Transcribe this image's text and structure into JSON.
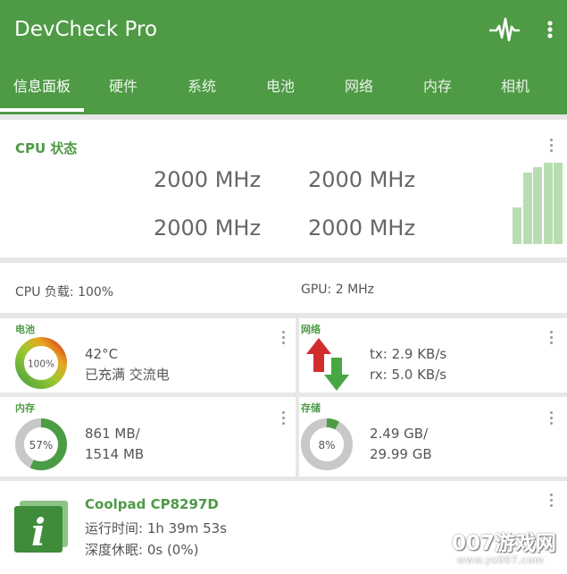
{
  "app": {
    "title": "DevCheck Pro",
    "icons": {
      "pulse": "pulse-icon",
      "more": "more-vert-icon"
    }
  },
  "tabs": [
    {
      "label": "信息面板",
      "active": true
    },
    {
      "label": "硬件"
    },
    {
      "label": "系统"
    },
    {
      "label": "电池"
    },
    {
      "label": "网络"
    },
    {
      "label": "内存"
    },
    {
      "label": "相机"
    }
  ],
  "cpu": {
    "title": "CPU 状态",
    "cores": [
      "2000 MHz",
      "2000 MHz",
      "2000 MHz",
      "2000 MHz"
    ],
    "load_bars": [
      0.45,
      0.88,
      0.95,
      1.0,
      1.0
    ]
  },
  "load": {
    "cpu": "CPU 负载: 100%",
    "gpu": "GPU: 2 MHz"
  },
  "battery": {
    "title": "电池",
    "percent_label": "100%",
    "percent": 100,
    "temp": "42°C",
    "status": "已充满 交流电"
  },
  "network": {
    "title": "网络",
    "tx": "tx: 2.9 KB/s",
    "rx": "rx: 5.0 KB/s"
  },
  "memory": {
    "title": "内存",
    "percent_label": "57%",
    "percent": 57,
    "used": "861 MB/",
    "total": "1514 MB"
  },
  "storage": {
    "title": "存储",
    "percent_label": "8%",
    "percent": 8,
    "used": "2.49 GB/",
    "total": "29.99 GB"
  },
  "device": {
    "name": "Coolpad CP8297D",
    "uptime": "运行时间: 1h 39m 53s",
    "deep_sleep": "深度休眠: 0s (0%)"
  },
  "watermark": {
    "main": "007游戏网",
    "sub": "www.yx007.com"
  },
  "colors": {
    "primary": "#4e9a45",
    "accent_light": "#b9ddb3",
    "arrow_up": "#d22d2d",
    "arrow_down": "#47a843"
  }
}
